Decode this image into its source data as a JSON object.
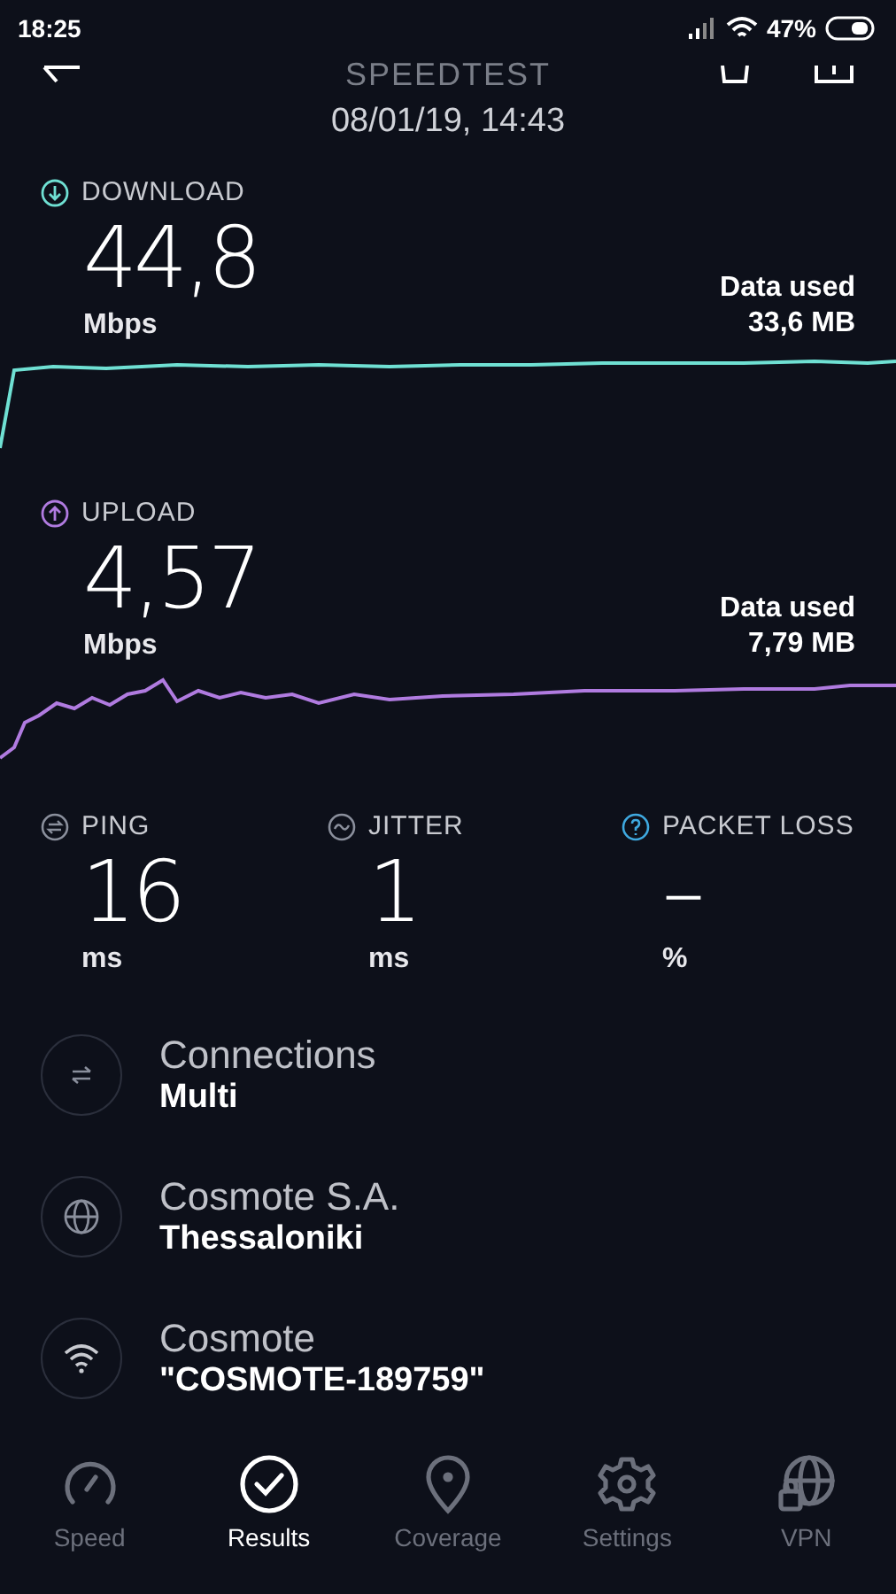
{
  "status_bar": {
    "time": "18:25",
    "battery": "47%"
  },
  "header": {
    "title": "SPEEDTEST",
    "date": "08/01/19, 14:43"
  },
  "results": [
    {
      "kind": "download",
      "label": "DOWNLOAD",
      "value": "44,8",
      "unit": "Mbps",
      "data_label": "Data used",
      "data_value": "33,6 MB"
    },
    {
      "kind": "upload",
      "label": "UPLOAD",
      "value": "4,57",
      "unit": "Mbps",
      "data_label": "Data used",
      "data_value": "7,79 MB"
    }
  ],
  "stats": [
    {
      "kind": "ping",
      "label": "PING",
      "value": "16",
      "unit": "ms"
    },
    {
      "kind": "jitter",
      "label": "JITTER",
      "value": "1",
      "unit": "ms"
    },
    {
      "kind": "loss",
      "label": "PACKET LOSS",
      "value": "–",
      "unit": "%"
    }
  ],
  "info": [
    {
      "kind": "connections",
      "title": "Connections",
      "subtitle": "Multi"
    },
    {
      "kind": "provider",
      "title": "Cosmote S.A.",
      "subtitle": "Thessaloniki"
    },
    {
      "kind": "network",
      "title": "Cosmote",
      "subtitle": "\"COSMOTE-189759\""
    }
  ],
  "nav": [
    {
      "kind": "speed",
      "label": "Speed",
      "selected": false
    },
    {
      "kind": "results",
      "label": "Results",
      "selected": true
    },
    {
      "kind": "coverage",
      "label": "Coverage",
      "selected": false
    },
    {
      "kind": "settings",
      "label": "Settings",
      "selected": false
    },
    {
      "kind": "vpn",
      "label": "VPN",
      "selected": false
    }
  ]
}
